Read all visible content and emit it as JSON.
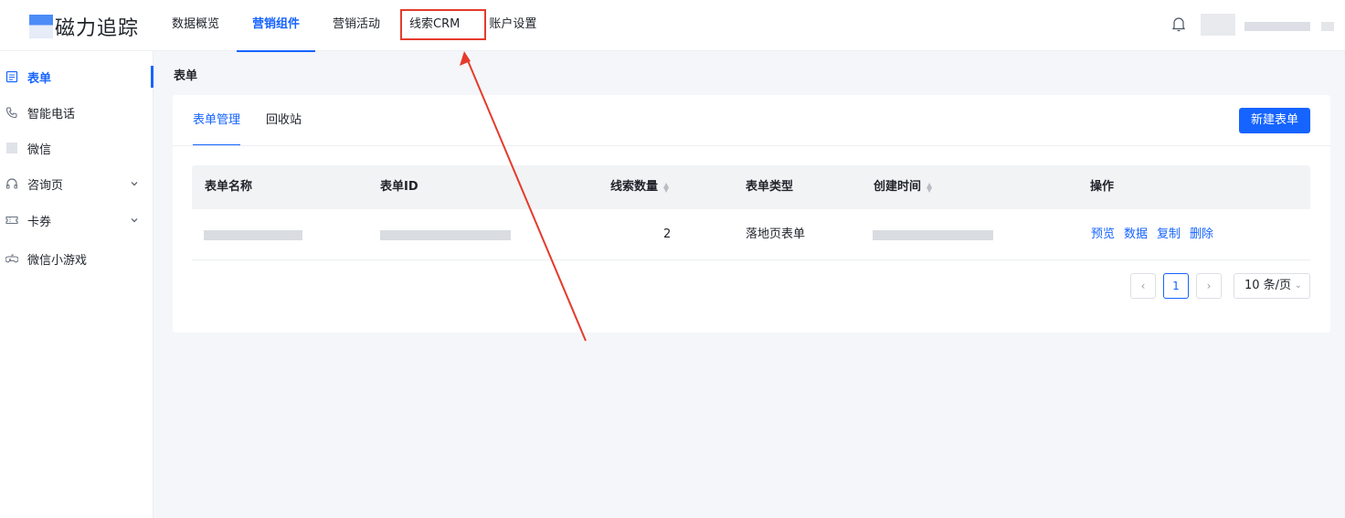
{
  "brand": {
    "name": "磁力追踪"
  },
  "nav": {
    "items": [
      {
        "label": "数据概览"
      },
      {
        "label": "营销组件"
      },
      {
        "label": "营销活动"
      },
      {
        "label": "线索CRM"
      },
      {
        "label": "账户设置"
      }
    ],
    "active": "营销组件",
    "highlighted": "线索CRM"
  },
  "sidebar": {
    "items": [
      {
        "label": "表单",
        "icon": "form-icon"
      },
      {
        "label": "智能电话",
        "icon": "phone-icon"
      },
      {
        "label": "微信",
        "icon": "wechat-icon"
      },
      {
        "label": "咨询页",
        "icon": "headset-icon"
      },
      {
        "label": "卡券",
        "icon": "ticket-icon"
      },
      {
        "label": "微信小游戏",
        "icon": "game-controller-icon"
      }
    ]
  },
  "page": {
    "title": "表单"
  },
  "tabs": [
    {
      "label": "表单管理"
    },
    {
      "label": "回收站"
    }
  ],
  "actions": {
    "new_label": "新建表单"
  },
  "table": {
    "headers": [
      "表单名称",
      "表单ID",
      "线索数量",
      "表单类型",
      "创建时间",
      "操作"
    ],
    "rows": [
      {
        "count": "2",
        "type": "落地页表单",
        "ops": [
          "预览",
          "数据",
          "复制",
          "删除"
        ]
      }
    ]
  },
  "pagination": {
    "current": "1",
    "page_size": "10 条/页"
  },
  "colors": {
    "accent": "#1664ff",
    "annotation": "#e53b2c"
  }
}
